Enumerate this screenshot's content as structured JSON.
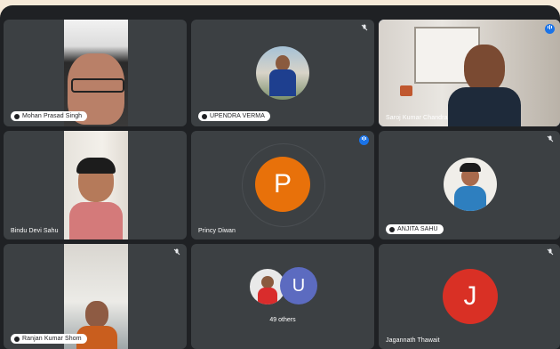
{
  "participants": [
    {
      "name": "Mohan Prasad Singh"
    },
    {
      "name": "UPENDRA VERMA"
    },
    {
      "name": "Saroj Kumar Chandra"
    },
    {
      "name": "Bindu Devi Sahu"
    },
    {
      "name": "Princy Diwan",
      "initial": "P"
    },
    {
      "name": "ANJITA SAHU"
    },
    {
      "name": "Ranjan Kumar Shom"
    },
    {
      "others_label": "49 others",
      "initial": "U"
    },
    {
      "name": "Jagannath Thawait",
      "initial": "J"
    }
  ],
  "colors": {
    "background": "#1f2124",
    "tile": "#3c4043",
    "active_outline": "#8ab4f8",
    "avatar_orange": "#e8710a",
    "avatar_red": "#d93025",
    "avatar_purple": "#5c6bc0",
    "speaking_mic": "#1a73e8"
  },
  "icons": [
    "pin-icon",
    "mic-off-icon",
    "mic-on-icon"
  ]
}
